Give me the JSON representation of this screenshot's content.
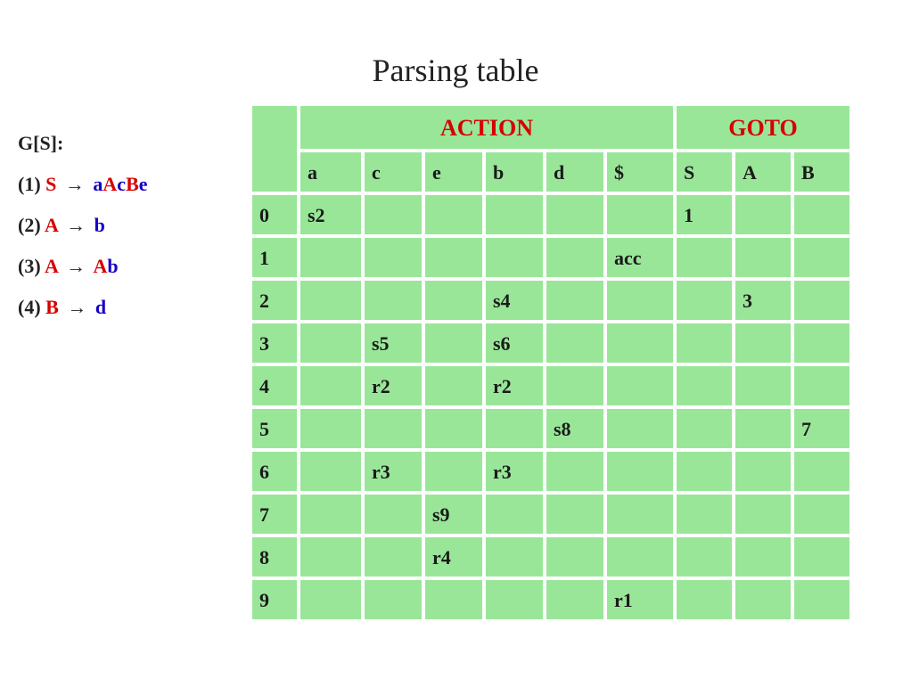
{
  "title": "Parsing table",
  "grammar": {
    "header": "G[S]:",
    "rules": {
      "r1": {
        "num": "(1)",
        "lhs": "S",
        "rhs": [
          {
            "t": "ter",
            "v": "a"
          },
          {
            "t": "nt",
            "v": "A"
          },
          {
            "t": "ter",
            "v": "c"
          },
          {
            "t": "nt",
            "v": "B"
          },
          {
            "t": "ter",
            "v": "e"
          }
        ]
      },
      "r2": {
        "num": "(2)",
        "lhs": "A",
        "rhs": [
          {
            "t": "ter",
            "v": "b"
          }
        ]
      },
      "r3": {
        "num": "(3)",
        "lhs": "A",
        "rhs": [
          {
            "t": "nt",
            "v": "A"
          },
          {
            "t": "ter",
            "v": "b"
          }
        ]
      },
      "r4": {
        "num": "(4)",
        "lhs": "B",
        "rhs": [
          {
            "t": "ter",
            "v": "d"
          }
        ]
      }
    },
    "arrow": "→"
  },
  "table": {
    "action_label": "ACTION",
    "goto_label": "GOTO",
    "action_cols": [
      "a",
      "c",
      "e",
      "b",
      "d",
      "$"
    ],
    "goto_cols": [
      "S",
      "A",
      "B"
    ],
    "rows": [
      {
        "state": "0",
        "a": "s2",
        "c": "",
        "e": "",
        "b": "",
        "d": "",
        "$": "",
        "S": "1",
        "A": "",
        "B": ""
      },
      {
        "state": "1",
        "a": "",
        "c": "",
        "e": "",
        "b": "",
        "d": "",
        "$": "acc",
        "S": "",
        "A": "",
        "B": ""
      },
      {
        "state": "2",
        "a": "",
        "c": "",
        "e": "",
        "b": "s4",
        "d": "",
        "$": "",
        "S": "",
        "A": "3",
        "B": ""
      },
      {
        "state": "3",
        "a": "",
        "c": "s5",
        "e": "",
        "b": "s6",
        "d": "",
        "$": "",
        "S": "",
        "A": "",
        "B": ""
      },
      {
        "state": "4",
        "a": "",
        "c": "r2",
        "e": "",
        "b": "r2",
        "d": "",
        "$": "",
        "S": "",
        "A": "",
        "B": ""
      },
      {
        "state": "5",
        "a": "",
        "c": "",
        "e": "",
        "b": "",
        "d": "s8",
        "$": "",
        "S": "",
        "A": "",
        "B": "7"
      },
      {
        "state": "6",
        "a": "",
        "c": "r3",
        "e": "",
        "b": "r3",
        "d": "",
        "$": "",
        "S": "",
        "A": "",
        "B": ""
      },
      {
        "state": "7",
        "a": "",
        "c": "",
        "e": "s9",
        "b": "",
        "d": "",
        "$": "",
        "S": "",
        "A": "",
        "B": ""
      },
      {
        "state": "8",
        "a": "",
        "c": "",
        "e": "r4",
        "b": "",
        "d": "",
        "$": "",
        "S": "",
        "A": "",
        "B": ""
      },
      {
        "state": "9",
        "a": "",
        "c": "",
        "e": "",
        "b": "",
        "d": "",
        "$": "r1",
        "S": "",
        "A": "",
        "B": ""
      }
    ]
  },
  "chart_data": {
    "type": "table",
    "title": "LR Parsing table for grammar G[S]",
    "grammar": [
      "S → a A c B e",
      "A → b",
      "A → A b",
      "B → d"
    ],
    "columns": {
      "ACTION": [
        "a",
        "c",
        "e",
        "b",
        "d",
        "$"
      ],
      "GOTO": [
        "S",
        "A",
        "B"
      ]
    },
    "rows": {
      "0": {
        "ACTION": {
          "a": "s2"
        },
        "GOTO": {
          "S": 1
        }
      },
      "1": {
        "ACTION": {
          "$": "acc"
        },
        "GOTO": {}
      },
      "2": {
        "ACTION": {
          "b": "s4"
        },
        "GOTO": {
          "A": 3
        }
      },
      "3": {
        "ACTION": {
          "c": "s5",
          "b": "s6"
        },
        "GOTO": {}
      },
      "4": {
        "ACTION": {
          "c": "r2",
          "b": "r2"
        },
        "GOTO": {}
      },
      "5": {
        "ACTION": {
          "d": "s8"
        },
        "GOTO": {
          "B": 7
        }
      },
      "6": {
        "ACTION": {
          "c": "r3",
          "b": "r3"
        },
        "GOTO": {}
      },
      "7": {
        "ACTION": {
          "e": "s9"
        },
        "GOTO": {}
      },
      "8": {
        "ACTION": {
          "e": "r4"
        },
        "GOTO": {}
      },
      "9": {
        "ACTION": {
          "$": "r1"
        },
        "GOTO": {}
      }
    }
  }
}
